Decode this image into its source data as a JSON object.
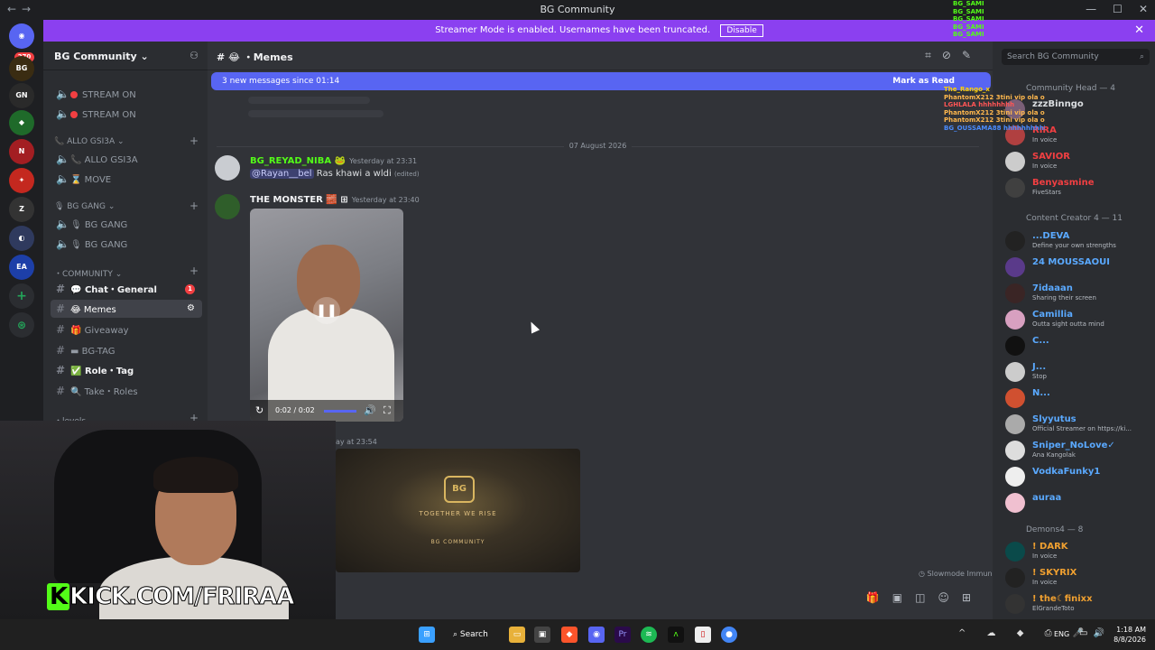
{
  "window": {
    "title": "BG Community",
    "controls": [
      "—",
      "☐",
      "✕"
    ]
  },
  "servers": {
    "home_badge": "270"
  },
  "streamer_banner": {
    "text": "Streamer Mode is enabled. Usernames have been truncated.",
    "button": "Disable"
  },
  "guild": {
    "name": "BG Community"
  },
  "sidebar": {
    "items": [
      {
        "label": "STREAM ON"
      },
      {
        "label": "STREAM ON"
      },
      {
        "label": "ALLO GSI3A"
      },
      {
        "label": "ALLO GSI3A"
      },
      {
        "label": "MOVE"
      },
      {
        "label": "BG GANG"
      },
      {
        "label": "BG GANG"
      },
      {
        "label": "BG GANG"
      },
      {
        "label": "COMMUNITY"
      },
      {
        "label": "Chat・General",
        "badge": "1"
      },
      {
        "label": "Memes"
      },
      {
        "label": "Giveaway"
      },
      {
        "label": "BG-TAG"
      },
      {
        "label": "Role・Tag"
      },
      {
        "label": "Take・Roles"
      },
      {
        "label": "levels"
      }
    ]
  },
  "channel": {
    "name": "Memes"
  },
  "new_messages": {
    "text": "3 new messages since 01:14",
    "action": "Mark as Read"
  },
  "date_divider": "07 August 2026",
  "messages": [
    {
      "author": "BG_REYAD_NIBA",
      "time": "Yesterday at 23:31",
      "mention": "@Rayan__bel",
      "text": "Ras khawi a wldi",
      "edited": "(edited)"
    },
    {
      "author": "THE MONSTER",
      "time": "Yesterday at 23:40"
    },
    {
      "time_partial": "ay at 23:54"
    }
  ],
  "video": {
    "time": "0:02 / 0:02",
    "progress": 1.0
  },
  "stadium": {
    "logo": "BG",
    "caption": "TOGETHER WE RISE",
    "banner": "BG COMMUNITY"
  },
  "slowmode": "Slowmode Immune",
  "kick_overlay": {
    "k": "K",
    "text": "KICK.COM/FRIRAA"
  },
  "members": {
    "search_placeholder": "Search BG Community",
    "categories": [
      {
        "label": "Community Head — 4"
      },
      {
        "label": "Content Creator 4 — 11"
      },
      {
        "label": "Demons4 — 8"
      }
    ],
    "list": [
      {
        "name": "zzzBinngo",
        "status": "",
        "color": "#dbdee1"
      },
      {
        "name": "RIRA",
        "status": "In voice",
        "color": "#f23f42"
      },
      {
        "name": "SAVIOR",
        "status": "In voice",
        "color": "#f23f42"
      },
      {
        "name": "Benyasmine",
        "status": "FiveStars",
        "color": "#f23f42"
      },
      {
        "name": "...DEVA",
        "status": "Define your own strengths",
        "color": "#5aa9ff"
      },
      {
        "name": "24 MOUSSAOUI",
        "status": "",
        "color": "#5aa9ff"
      },
      {
        "name": "7idaaan",
        "status": "Sharing their screen",
        "color": "#5aa9ff"
      },
      {
        "name": "Camillia",
        "status": "Outta sight outta mind",
        "color": "#5aa9ff"
      },
      {
        "name": "C...",
        "status": "",
        "color": "#5aa9ff"
      },
      {
        "name": "J...",
        "status": "Stop",
        "color": "#5aa9ff"
      },
      {
        "name": "N...",
        "status": "",
        "color": "#5aa9ff"
      },
      {
        "name": "Slyyutus",
        "status": "Official Streamer on https://ki...",
        "color": "#5aa9ff"
      },
      {
        "name": "Sniper_NoLove✓",
        "status": "Ana Kangolak",
        "color": "#5aa9ff"
      },
      {
        "name": "VodkaFunky1",
        "status": "",
        "color": "#5aa9ff"
      },
      {
        "name": "aurаа",
        "status": "",
        "color": "#5aa9ff"
      },
      {
        "name": "! DARK",
        "status": "In voice",
        "color": "#f0a030"
      },
      {
        "name": "! SKYRIX",
        "status": "In voice",
        "color": "#f0a030"
      },
      {
        "name": "! the☾finixx",
        "status": "ElGrandeToto",
        "color": "#f0a030"
      }
    ]
  },
  "stream_chat": [
    {
      "text": "BG_SAMI",
      "color": "#53fc18"
    },
    {
      "text": "BG_SAMI",
      "color": "#53fc18"
    },
    {
      "text": "BG_SAMI",
      "color": "#53fc18"
    },
    {
      "text": "BG_SAMI",
      "color": "#53fc18"
    },
    {
      "text": "BG_SAMI",
      "color": "#53fc18"
    },
    {
      "text": "The_Rango_x",
      "color": "#ffd000"
    },
    {
      "text": "PhantomX212 3tini vip ola og",
      "color": "#ffb84d"
    },
    {
      "text": "LGHLALA hhhhhhhh",
      "color": "#ff5555"
    },
    {
      "text": "PhantomX212 3tini vip ola og",
      "color": "#ffb84d"
    },
    {
      "text": "PhantomX212 3tini vip ola og",
      "color": "#ffb84d"
    },
    {
      "text": "BG_OUSSAMA88 hhhhhhhhhh",
      "color": "#4a8cff"
    }
  ],
  "taskbar": {
    "search": "Search",
    "lang": "ENG",
    "time": "1:18 AM",
    "date": "8/8/2026"
  }
}
